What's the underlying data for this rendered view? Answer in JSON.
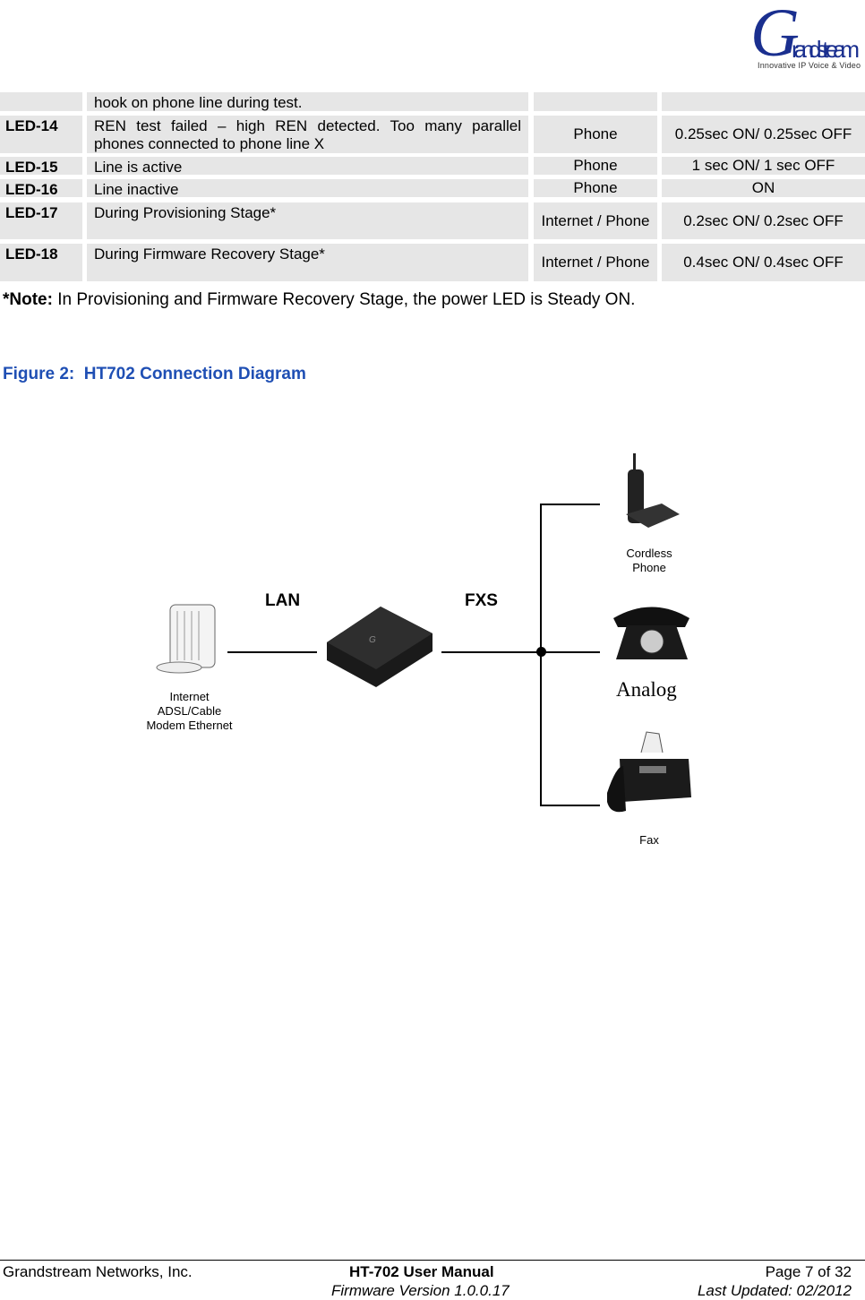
{
  "logo": {
    "brand": "Grandstream",
    "tagline": "Innovative IP Voice & Video"
  },
  "table": {
    "rows": [
      {
        "led": "",
        "desc": "hook on phone line during test.",
        "type": "",
        "pattern": ""
      },
      {
        "led": "LED-14",
        "desc": "REN test failed – high REN detected. Too many parallel phones connected to phone line X",
        "type": "Phone",
        "pattern": "0.25sec ON/ 0.25sec OFF"
      },
      {
        "led": "LED-15",
        "desc": "Line is active",
        "type": "Phone",
        "pattern": "1 sec ON/ 1 sec OFF"
      },
      {
        "led": "LED-16",
        "desc": "Line inactive",
        "type": "Phone",
        "pattern": "ON"
      },
      {
        "led": "LED-17",
        "desc": "During Provisioning Stage*",
        "type": "Internet / Phone",
        "pattern": "0.2sec ON/ 0.2sec OFF"
      },
      {
        "led": "LED-18",
        "desc": "During Firmware Recovery Stage*",
        "type": "Internet / Phone",
        "pattern": "0.4sec ON/ 0.4sec OFF"
      }
    ]
  },
  "note": {
    "label": "*Note:",
    "text": " In Provisioning and Firmware Recovery Stage, the power LED is Steady ON."
  },
  "figure": {
    "caption": "Figure 2:  HT702 Connection Diagram",
    "lan": "LAN",
    "fxs": "FXS",
    "modem": "Internet ADSL/Cable Modem Ethernet",
    "cordless": "Cordless Phone",
    "analog": "Analog",
    "fax": "Fax",
    "caption_color": "#1f4fb4"
  },
  "footer": {
    "company": "Grandstream Networks, Inc.",
    "title": "HT-702 User Manual",
    "firmware": "Firmware Version 1.0.0.17",
    "page": "Page 7 of 32",
    "updated": "Last Updated: 02/2012"
  }
}
